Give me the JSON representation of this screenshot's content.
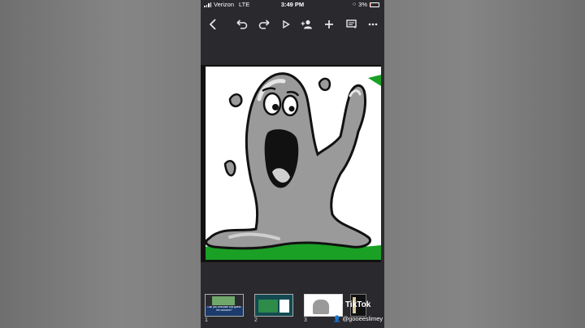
{
  "status_bar": {
    "carrier": "Verizon",
    "network": "LTE",
    "time": "3:49 PM",
    "battery": "3%",
    "battery_level": 0.03
  },
  "toolbar": {
    "icons": [
      "back-chevron-icon",
      "undo-icon",
      "redo-icon",
      "play-icon",
      "add-person-icon",
      "plus-icon",
      "comment-icon",
      "more-icon"
    ]
  },
  "slide": {
    "image": "gray-slime-cartoon"
  },
  "filmstrip": {
    "thumbnails": [
      {
        "number": "1",
        "caption": "Can you articulate and guess the outcome?"
      },
      {
        "number": "2",
        "caption": ""
      },
      {
        "number": "3",
        "caption": ""
      }
    ]
  },
  "watermark": {
    "brand": "TikTok",
    "handle": "@gooeeslimey"
  },
  "colors": {
    "background": "#7a7a7a",
    "phone_bg": "#2a2a2e",
    "slime_gray": "#9a9a9a",
    "accent_green": "#1aa024"
  }
}
